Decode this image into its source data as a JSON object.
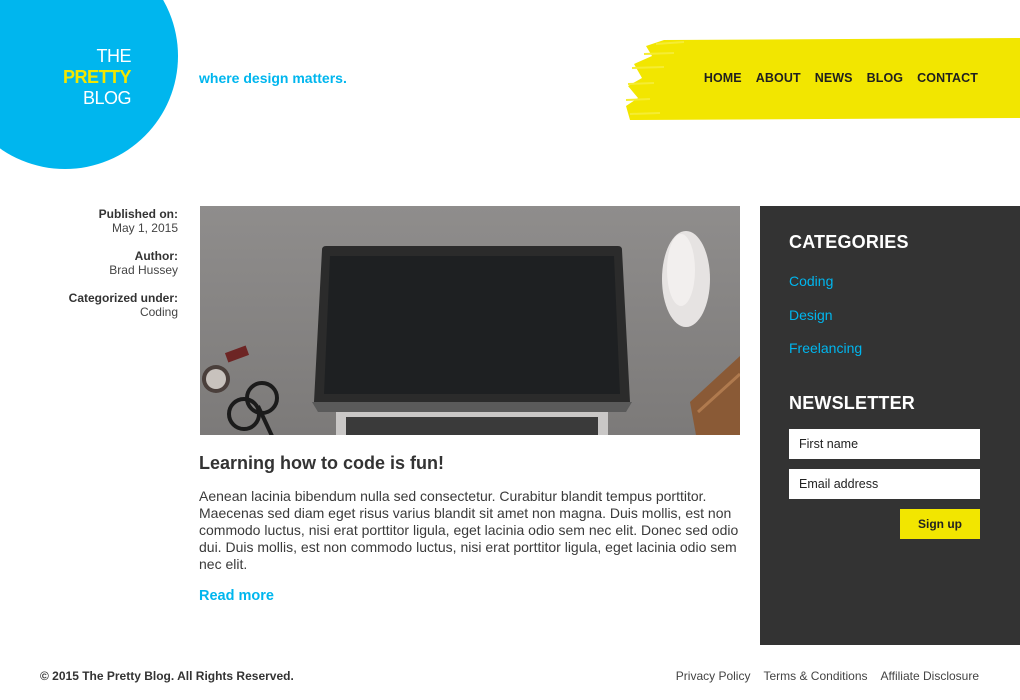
{
  "brand": {
    "line1": "THE",
    "line2": "PRETTY",
    "line3": "BLOG",
    "tagline": "where design matters.",
    "primary_color": "#00b6ee",
    "accent_color": "#f2e600"
  },
  "nav": {
    "items": [
      {
        "label": "HOME"
      },
      {
        "label": "ABOUT"
      },
      {
        "label": "NEWS"
      },
      {
        "label": "BLOG"
      },
      {
        "label": "CONTACT"
      }
    ]
  },
  "post": {
    "published_label": "Published on:",
    "published_value": "May 1, 2015",
    "author_label": "Author:",
    "author_value": "Brad Hussey",
    "category_label": "Categorized under:",
    "category_value": "Coding",
    "title": "Learning how to code is fun!",
    "body": "Aenean lacinia bibendum nulla sed consectetur. Curabitur blandit tempus porttitor. Maecenas sed diam eget risus varius blandit sit amet non magna. Duis mollis, est non commodo luctus, nisi erat porttitor ligula, eget lacinia odio sem nec elit. Donec sed odio dui. Duis mollis, est non commodo luctus, nisi erat porttitor ligula, eget lacinia odio sem nec elit.",
    "read_more": "Read more"
  },
  "sidebar": {
    "categories_title": "CATEGORIES",
    "categories": [
      "Coding",
      "Design",
      "Freelancing"
    ],
    "newsletter_title": "NEWSLETTER",
    "first_name_placeholder": "First name",
    "email_placeholder": "Email address",
    "signup_label": "Sign up"
  },
  "footer": {
    "copyright": "© 2015 The Pretty Blog. All Rights Reserved.",
    "links": [
      "Privacy Policy",
      "Terms & Conditions",
      "Affiliate Disclosure"
    ]
  }
}
